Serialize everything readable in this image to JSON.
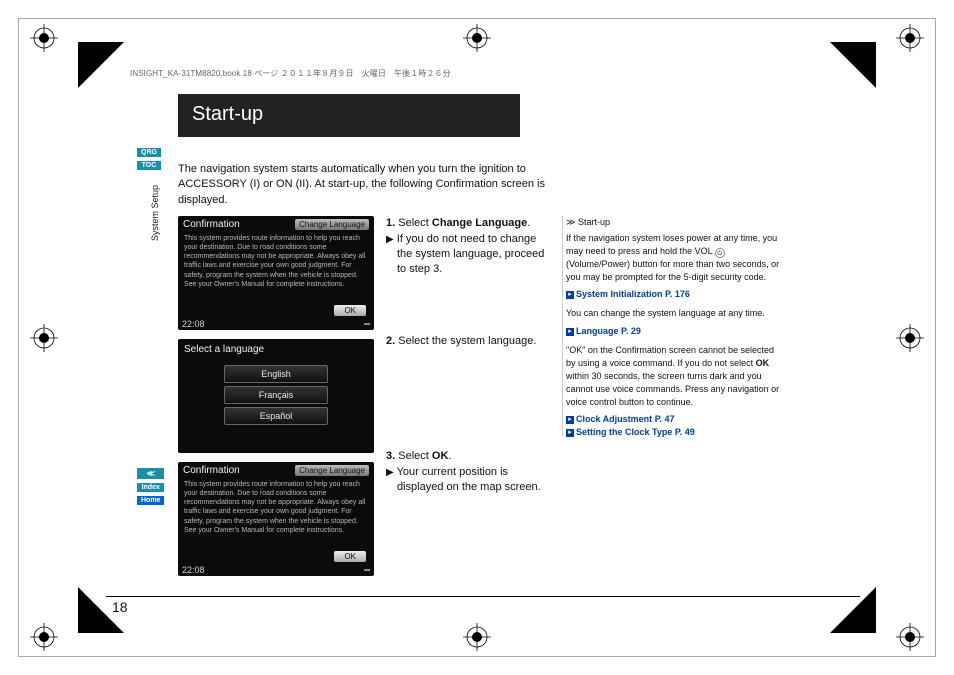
{
  "header_line": "INSIGHT_KA-31TM8820.book  18 ページ  ２０１１年８月９日　火曜日　午後１時２６分",
  "section_title": "Start-up",
  "tabs": {
    "qrg": "QRG",
    "toc": "TOC",
    "voice": "≪",
    "index": "Index",
    "home": "Home"
  },
  "side_text": "System Setup",
  "intro": "The navigation system starts automatically when you turn the ignition to ACCESSORY (I) or ON (II). At start-up, the following Confirmation screen is displayed.",
  "steps": {
    "s1_label": "1.",
    "s1_text": "Select ",
    "s1_bold": "Change Language",
    "s1_period": ".",
    "s1_sub": "If you do not need to change the system language, proceed to step 3.",
    "s2_label": "2.",
    "s2_text": "Select the system language.",
    "s3_label": "3.",
    "s3_text": "Select ",
    "s3_bold": "OK",
    "s3_period": ".",
    "s3_sub": "Your current position is displayed on the map screen."
  },
  "right": {
    "head_marker": "≫",
    "head": "Start-up",
    "p1a": "If the navigation system loses power at any time, you may need to press and hold the VOL ",
    "p1_vol": "⏻",
    "p1b": " (Volume/Power) button for more than two seconds, or you may be prompted for the 5-digit security code.",
    "link1": "System Initialization",
    "link1_page": "P. 176",
    "p2": "You can change the system language at any time.",
    "link2": "Language",
    "link2_page": "P. 29",
    "p3a": "\"OK\" on the Confirmation screen cannot be selected by using a voice command. If you do not select ",
    "p3_bold": "OK",
    "p3b": " within 30 seconds, the screen turns dark and you cannot use voice commands. Press any navigation or voice control button to continue.",
    "link3": "Clock Adjustment",
    "link3_page": "P. 47",
    "link4": "Setting the Clock Type",
    "link4_page": "P. 49"
  },
  "nav": {
    "confirm_title": "Confirmation",
    "change_lang_btn": "Change Language",
    "conf_desc": "This system provides route information to help you reach your destination. Due to road conditions some recommendations may not be appropriate. Always obey all traffic laws and exercise your own good judgment. For safety, program the system when the vehicle is stopped. See your Owner's Manual for complete instructions.",
    "ok_btn": "OK",
    "time": "22:08",
    "sel_lang_title": "Select a language",
    "langs": {
      "en": "English",
      "fr": "Français",
      "es": "Español"
    }
  },
  "page_number": "18"
}
